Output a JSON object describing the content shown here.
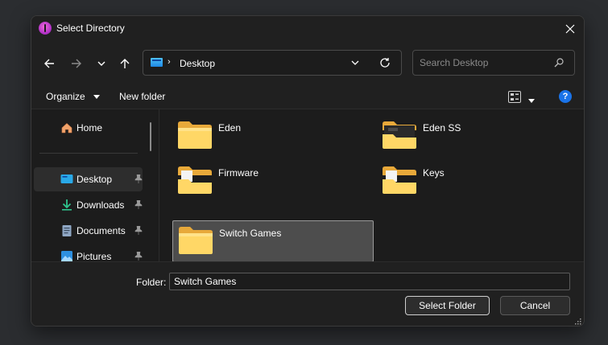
{
  "window": {
    "title": "Select Directory",
    "app_icon": "app-icon",
    "close_icon": "close-icon"
  },
  "toolbar": {
    "back_icon": "arrow-left-icon",
    "forward_icon": "arrow-right-icon",
    "recent_icon": "chevron-down-icon",
    "up_icon": "arrow-up-icon",
    "address": {
      "path": "Desktop",
      "separator": "›",
      "dropdown_icon": "chevron-down-icon",
      "refresh_icon": "refresh-icon"
    },
    "search": {
      "placeholder": "Search Desktop",
      "value": "",
      "icon": "search-icon"
    }
  },
  "commandbar": {
    "organize_label": "Organize",
    "new_folder_label": "New folder",
    "view_icon": "view-options-icon",
    "help_label": "?"
  },
  "sidebar": {
    "items": [
      {
        "label": "Home",
        "icon": "home-icon",
        "pinned": false,
        "selected": false
      },
      {
        "label": "Desktop",
        "icon": "desktop-icon",
        "pinned": true,
        "selected": true
      },
      {
        "label": "Downloads",
        "icon": "download-icon",
        "pinned": true,
        "selected": false
      },
      {
        "label": "Documents",
        "icon": "documents-icon",
        "pinned": true,
        "selected": false
      },
      {
        "label": "Pictures",
        "icon": "pictures-icon",
        "pinned": true,
        "selected": false
      }
    ]
  },
  "files": [
    {
      "name": "Eden",
      "icon": "folder-icon",
      "selected": false
    },
    {
      "name": "Eden SS",
      "icon": "folder-icon",
      "selected": false
    },
    {
      "name": "Firmware",
      "icon": "folder-icon",
      "selected": false
    },
    {
      "name": "Keys",
      "icon": "folder-icon",
      "selected": false
    },
    {
      "name": "Switch Games",
      "icon": "folder-icon",
      "selected": true
    }
  ],
  "footer": {
    "folder_label": "Folder:",
    "folder_value": "Switch Games",
    "select_button": "Select Folder",
    "cancel_button": "Cancel"
  },
  "colors": {
    "background": "#1c1c1c",
    "chrome": "#202020",
    "folder_yellow": "#f5c542",
    "accent_blue": "#1a73e8"
  }
}
